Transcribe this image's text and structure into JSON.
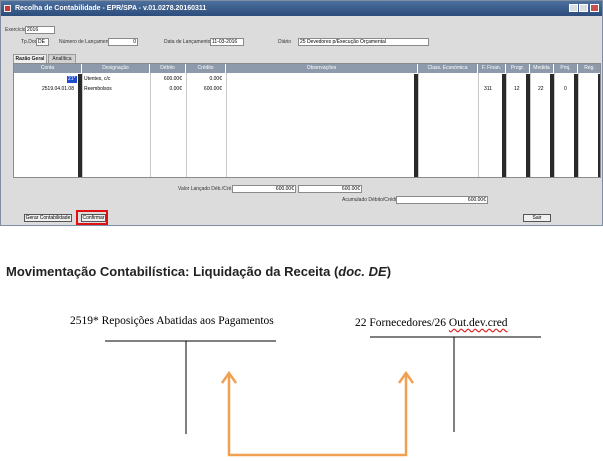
{
  "window": {
    "title": "Recolha de Contabilidade - EPR/SPA - v.01.0278.20160311"
  },
  "form": {
    "exercicio_label": "Exercício",
    "exercicio_value": "2016",
    "tipo_doc_label": "Tp.Doc",
    "tipo_doc_value": "DE",
    "num_lancamento_label": "Número de Lançamento",
    "num_lancamento_value": "0",
    "data_lancamento_label": "Data de Lançamento",
    "data_lancamento_value": "11-03-2016",
    "diario_label": "Diário",
    "diario_value": "25 Devedores p/Execução Orçamental"
  },
  "tabs": [
    {
      "label": "Razão Geral"
    },
    {
      "label": "Analítica"
    }
  ],
  "grid": {
    "columns": [
      "Conta",
      "Designação",
      "Débito",
      "Crédito",
      "Observações",
      "Class. Económica",
      "F. Finan.",
      "Progr.",
      "Medida",
      "Proj.",
      "Reg."
    ],
    "rows": [
      {
        "conta": "21*",
        "designacao": "Utentes, c/c",
        "debito": "600.00€",
        "credito": "0.00€",
        "class": "",
        "ffin": "",
        "progr": "",
        "medida": "",
        "proj": ""
      },
      {
        "conta": "2519.04.01.08",
        "designacao": "Reembolsos",
        "debito": "0.00€",
        "credito": "600.00€",
        "class": "",
        "ffin": "311",
        "progr": "12",
        "medida": "22",
        "proj": "0"
      }
    ]
  },
  "totals": {
    "label": "Valor Lançado Déb./Cré.",
    "debito": "600.00€",
    "credito": "600.00€",
    "acumulado_label": "Acumulado Débito/Crédito",
    "acumulado_value": "600.00€"
  },
  "buttons": {
    "gerar": "Gerar Contabilidade",
    "confirmar": "Confirmar",
    "sair": "Sair"
  },
  "heading": {
    "text": "Movimentação Contabilística: Liquidação da Receita (",
    "italic": "doc. DE",
    "close": ")"
  },
  "accounts": {
    "left": "2519* Reposições Abatidas aos Pagamentos",
    "right_plain": "22 Fornecedores/26 ",
    "right_underlined": "Out.dev.cred"
  },
  "colors": {
    "highlight_box": "#e01010",
    "arrow": "#f0a050",
    "grid_header": "#8d9aab",
    "title_bar": "#3a5c8c"
  }
}
